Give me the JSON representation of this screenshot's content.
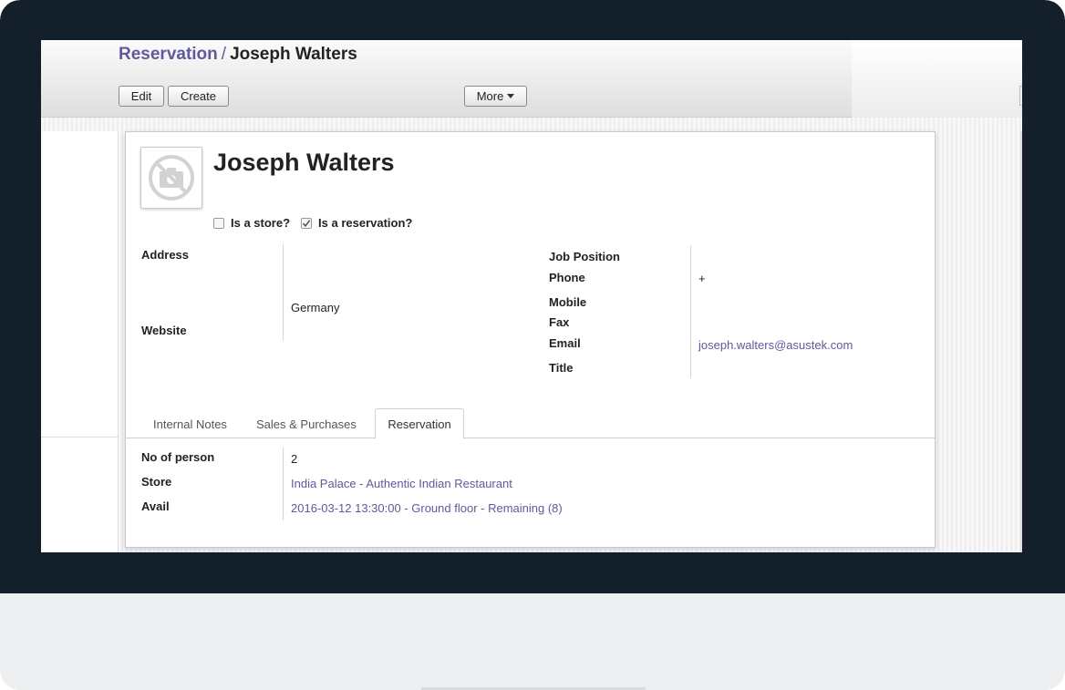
{
  "breadcrumb": {
    "parent": "Reservation",
    "separator": "/",
    "current": "Joseph Walters"
  },
  "toolbar": {
    "edit_label": "Edit",
    "create_label": "Create",
    "more_label": "More"
  },
  "record": {
    "name": "Joseph Walters",
    "is_store_label": "Is a store?",
    "is_store_checked": false,
    "is_reservation_label": "Is a reservation?",
    "is_reservation_checked": true
  },
  "left_fields": {
    "address_label": "Address",
    "address_value": "Germany",
    "website_label": "Website"
  },
  "right_fields": {
    "job_position_label": "Job Position",
    "phone_label": "Phone",
    "phone_value": "+",
    "mobile_label": "Mobile",
    "fax_label": "Fax",
    "email_label": "Email",
    "email_value": "joseph.walters@asustek.com",
    "title_label": "Title"
  },
  "tabs": [
    {
      "label": "Internal Notes",
      "active": false
    },
    {
      "label": "Sales & Purchases",
      "active": false
    },
    {
      "label": "Reservation",
      "active": true
    }
  ],
  "reservation_fields": {
    "no_of_person_label": "No of person",
    "no_of_person_value": "2",
    "store_label": "Store",
    "store_value": "India Palace - Authentic Indian Restaurant",
    "avail_label": "Avail",
    "avail_value": "2016-03-12 13:30:00 - Ground floor - Remaining (8)"
  },
  "icons": {
    "avatar": "no-photo-camera-icon",
    "more_caret": "caret-down-icon",
    "checkmark": "checkmark-icon"
  },
  "colors": {
    "link": "#5f5a9b",
    "bezel": "#13202c",
    "text": "#222222"
  }
}
